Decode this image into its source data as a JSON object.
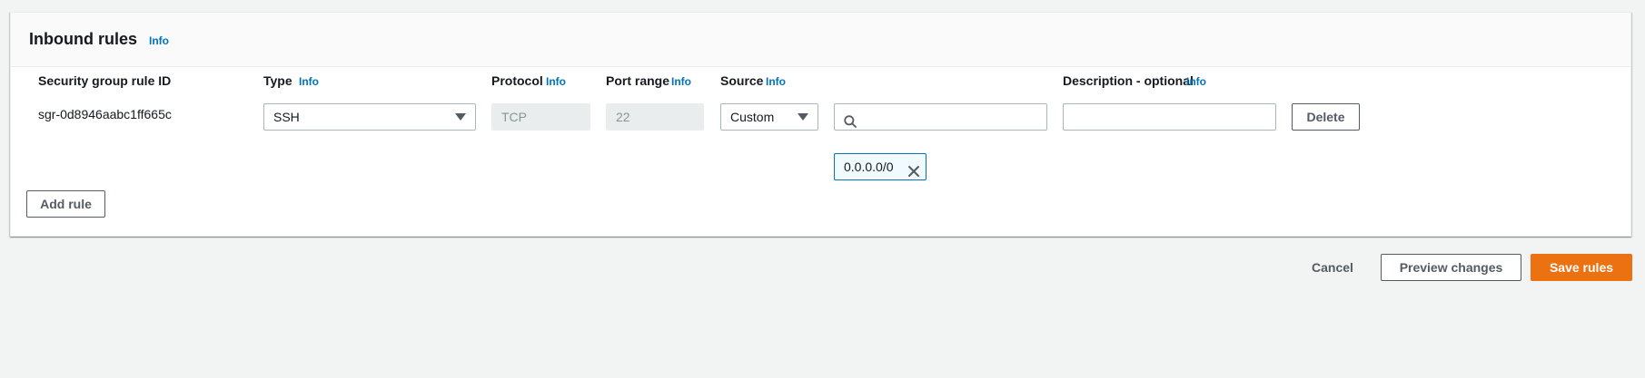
{
  "panel": {
    "title": "Inbound rules",
    "info": "Info"
  },
  "columns": {
    "rule_id": "Security group rule ID",
    "type": "Type",
    "type_info": "Info",
    "protocol": "Protocol",
    "protocol_info": "Info",
    "port_range": "Port range",
    "port_range_info": "Info",
    "source": "Source",
    "source_info": "Info",
    "description": "Description - optional",
    "description_info": "Info"
  },
  "rule": {
    "id": "sgr-0d8946aabc1ff665c",
    "type": "SSH",
    "protocol": "TCP",
    "port_range": "22",
    "source_type": "Custom",
    "source_search_value": "",
    "source_token": "0.0.0.0/0",
    "description_value": "",
    "delete_label": "Delete"
  },
  "actions": {
    "add_rule": "Add rule",
    "cancel": "Cancel",
    "preview_changes": "Preview changes",
    "save_rules": "Save rules"
  },
  "colors": {
    "accent": "#0073bb",
    "primary_button": "#ec7211",
    "page_background": "#f2f3f3"
  },
  "icons": {
    "type_select": "caret-down-icon",
    "source_select": "caret-down-icon",
    "source_search": "search-icon",
    "token_remove": "close-icon"
  }
}
